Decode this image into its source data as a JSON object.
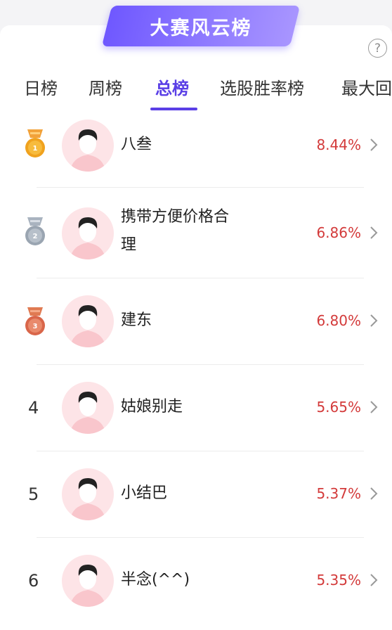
{
  "header": {
    "title": "大赛风云榜",
    "help_symbol": "?"
  },
  "tabs": [
    {
      "label": "日榜",
      "active": false
    },
    {
      "label": "周榜",
      "active": false
    },
    {
      "label": "总榜",
      "active": true
    },
    {
      "label": "选股胜率榜",
      "active": false
    },
    {
      "label": "最大回",
      "active": false
    }
  ],
  "colors": {
    "accent": "#5a3fe6",
    "banner": "#7b63ff",
    "percent": "#d33a3a"
  },
  "rankings": [
    {
      "rank": "1",
      "medal": "gold",
      "name": "八叁",
      "percent": "8.44%"
    },
    {
      "rank": "2",
      "medal": "silver",
      "name": "携带方便价格合理",
      "percent": "6.86%"
    },
    {
      "rank": "3",
      "medal": "bronze",
      "name": "建东",
      "percent": "6.80%"
    },
    {
      "rank": "4",
      "medal": null,
      "name": "姑娘别走",
      "percent": "5.65%"
    },
    {
      "rank": "5",
      "medal": null,
      "name": "小结巴",
      "percent": "5.37%"
    },
    {
      "rank": "6",
      "medal": null,
      "name": "半念(^^)",
      "percent": "5.35%"
    }
  ]
}
